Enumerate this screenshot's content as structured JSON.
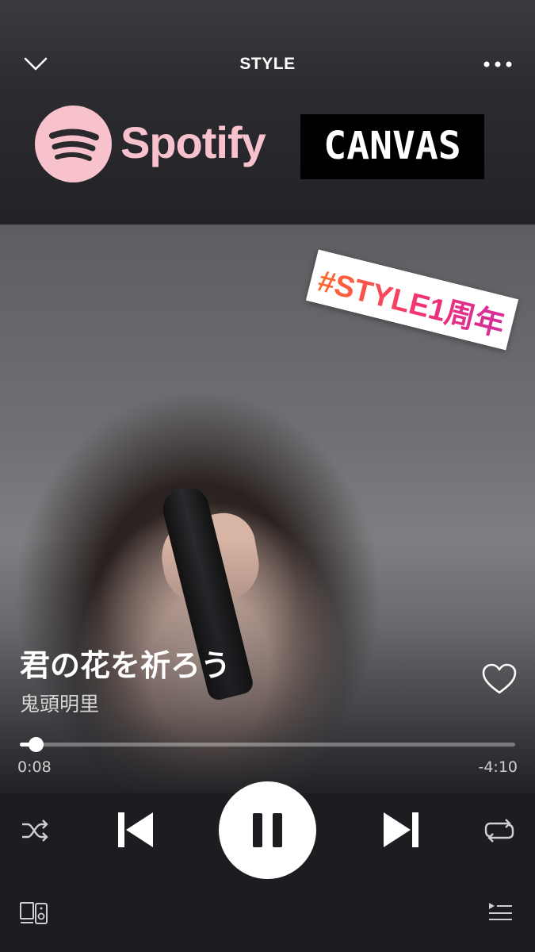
{
  "header": {
    "title": "STYLE",
    "left_icon": "chevron-down-icon",
    "right_icon": "more-options-icon"
  },
  "overlay": {
    "spotify_label": "Spotify",
    "canvas_label": "CANVAS",
    "hashtag": "#STYLE1周年"
  },
  "track": {
    "title": "君の花を祈ろう",
    "artist": "鬼頭明里",
    "liked_icon": "heart-outline-icon"
  },
  "progress": {
    "elapsed": "0:08",
    "remaining": "-4:10",
    "fraction": 0.032
  },
  "controls": {
    "shuffle_icon": "shuffle-icon",
    "previous_icon": "skip-previous-icon",
    "play_state_icon": "pause-icon",
    "next_icon": "skip-next-icon",
    "repeat_icon": "repeat-icon",
    "devices_icon": "devices-icon",
    "queue_icon": "queue-icon"
  },
  "colors": {
    "spotify_pink": "#f7c2cc",
    "hashtag_start": "#ff6a2b",
    "hashtag_end": "#d12f9c",
    "background": "#1c1c20"
  }
}
